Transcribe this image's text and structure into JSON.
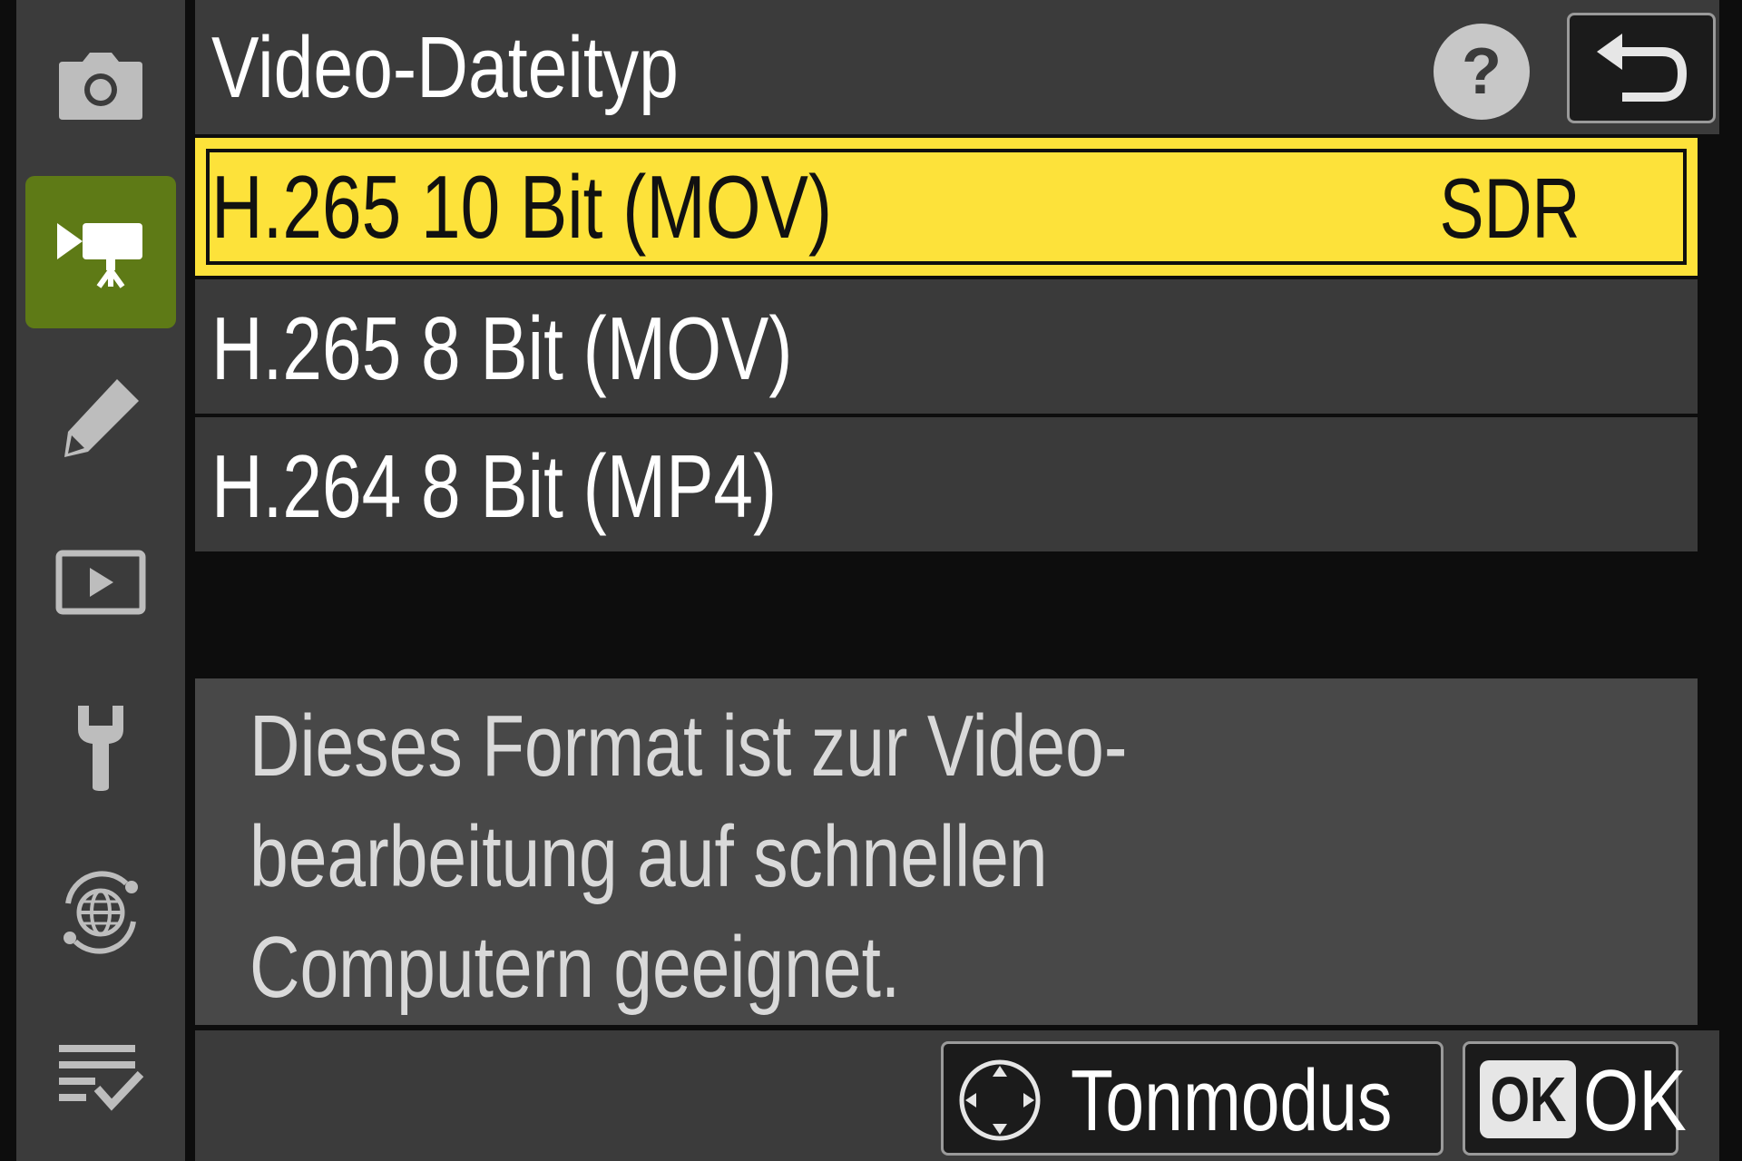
{
  "header": {
    "title": "Video-Dateityp",
    "help_label": "?"
  },
  "sidebar": {
    "items": [
      {
        "name": "photo-shooting-menu",
        "icon": "camera-icon",
        "active": false
      },
      {
        "name": "video-recording-menu",
        "icon": "movie-camera-icon",
        "active": true
      },
      {
        "name": "custom-settings-menu",
        "icon": "pencil-icon",
        "active": false
      },
      {
        "name": "playback-menu",
        "icon": "playback-icon",
        "active": false
      },
      {
        "name": "setup-menu",
        "icon": "wrench-icon",
        "active": false
      },
      {
        "name": "network-menu",
        "icon": "network-globe-icon",
        "active": false
      },
      {
        "name": "my-menu",
        "icon": "checklist-icon",
        "active": false
      }
    ]
  },
  "list": {
    "items": [
      {
        "label": "H.265 10 Bit (MOV)",
        "value": "SDR",
        "selected": true
      },
      {
        "label": "H.265 8 Bit (MOV)",
        "value": "",
        "selected": false
      },
      {
        "label": "H.264 8 Bit (MP4)",
        "value": "",
        "selected": false
      }
    ]
  },
  "description": {
    "lines": [
      "Dieses Format ist zur Video-",
      "bearbeitung auf schnellen",
      "Computern geeignet."
    ]
  },
  "footer": {
    "tonmodus_label": "Tonmodus",
    "ok_badge": "OK",
    "ok_label": "OK"
  },
  "colors": {
    "accent_selected": "#fde23a",
    "active_tab": "#5e7a16",
    "panel": "#3b3b3b",
    "background": "#0d0d0d"
  }
}
